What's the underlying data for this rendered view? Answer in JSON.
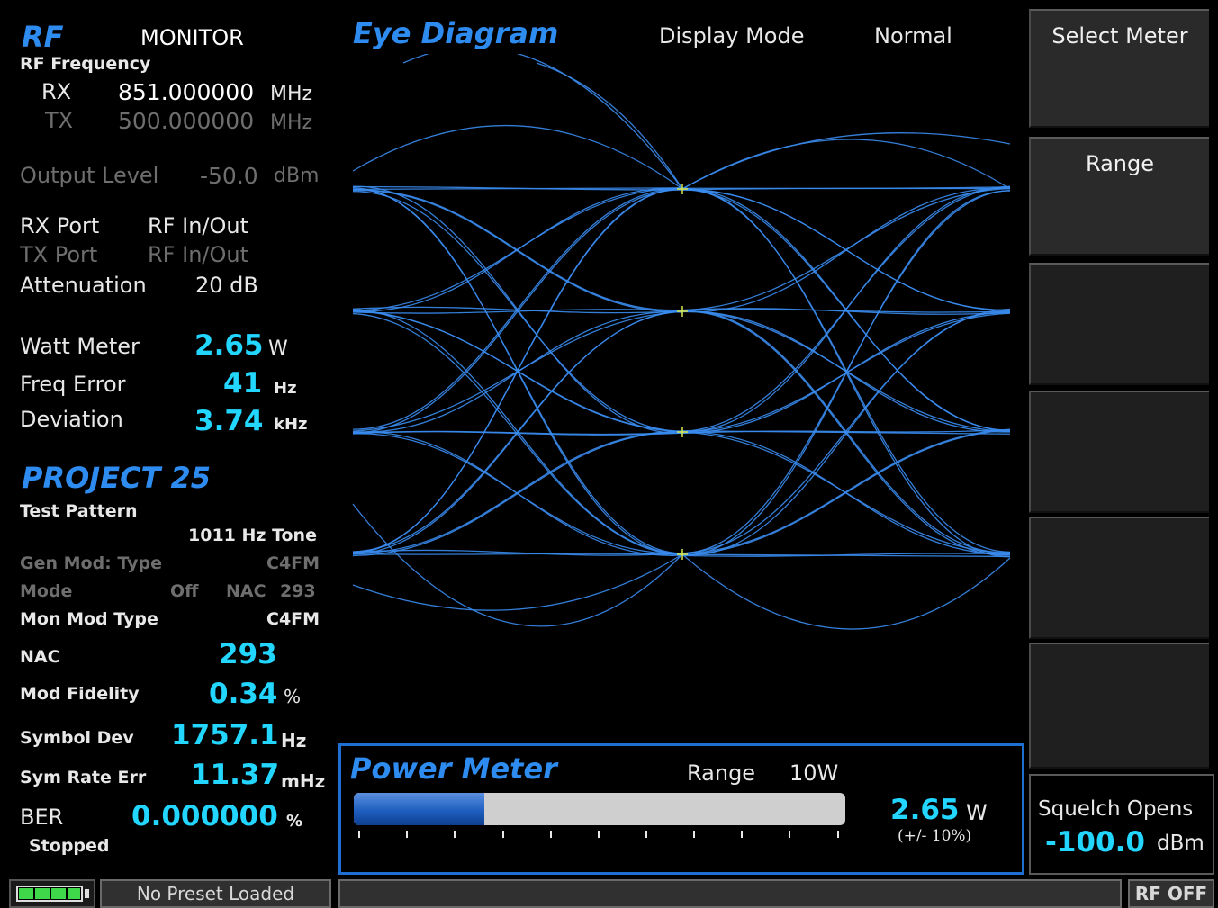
{
  "rf": {
    "title": "RF",
    "mode": "MONITOR",
    "rf_frequency_label": "RF Frequency",
    "rx_label": "RX",
    "rx_value": "851.000000",
    "rx_unit": "MHz",
    "tx_label": "TX",
    "tx_value": "500.000000",
    "tx_unit": "MHz",
    "output_level_label": "Output Level",
    "output_level_value": "-50.0",
    "output_level_unit": "dBm",
    "rx_port_label": "RX Port",
    "rx_port_value": "RF In/Out",
    "tx_port_label": "TX Port",
    "tx_port_value": "RF In/Out",
    "attenuation_label": "Attenuation",
    "attenuation_value": "20 dB",
    "watt_meter_label": "Watt Meter",
    "watt_meter_value": "2.65",
    "watt_meter_unit": "W",
    "freq_error_label": "Freq Error",
    "freq_error_value": "41",
    "freq_error_unit": "Hz",
    "deviation_label": "Deviation",
    "deviation_value": "3.74",
    "deviation_unit": "kHz"
  },
  "p25": {
    "title": "PROJECT 25",
    "test_pattern_label": "Test Pattern",
    "test_pattern_value": "1011 Hz Tone",
    "gen_mod_type_label": "Gen Mod: Type",
    "gen_mod_type_value": "C4FM",
    "mode_label": "Mode",
    "mode_value": "Off",
    "nac_gen_label": "NAC",
    "nac_gen_value": "293",
    "mon_mod_type_label": "Mon Mod Type",
    "mon_mod_type_value": "C4FM",
    "nac_label": "NAC",
    "nac_value": "293",
    "mod_fidelity_label": "Mod Fidelity",
    "mod_fidelity_value": "0.34",
    "mod_fidelity_unit": "%",
    "symbol_dev_label": "Symbol Dev",
    "symbol_dev_value": "1757.1",
    "symbol_dev_unit": "Hz",
    "sym_rate_err_label": "Sym Rate Err",
    "sym_rate_err_value": "11.37",
    "sym_rate_err_unit": "mHz",
    "ber_label": "BER",
    "ber_value": "0.000000",
    "ber_unit": "%",
    "ber_status": "Stopped"
  },
  "eye": {
    "title": "Eye Diagram",
    "display_mode_label": "Display Mode",
    "display_mode_value": "Normal",
    "trace_color": "#3a8cf0"
  },
  "power_meter": {
    "title": "Power Meter",
    "range_label": "Range",
    "range_value": "10W",
    "value": "2.65",
    "unit": "W",
    "tolerance": "(+/- 10%)",
    "fill_fraction": 0.265
  },
  "softkeys": {
    "select_meter": "Select Meter",
    "range": "Range",
    "squelch_label": "Squelch Opens",
    "squelch_value": "-100.0",
    "squelch_unit": "dBm"
  },
  "status": {
    "preset": "No Preset Loaded",
    "rf_state": "RF OFF"
  },
  "colors": {
    "accent_cyan": "#22d6ff",
    "heading_blue": "#2e8cf0",
    "panel_border": "#1f6fd0"
  }
}
